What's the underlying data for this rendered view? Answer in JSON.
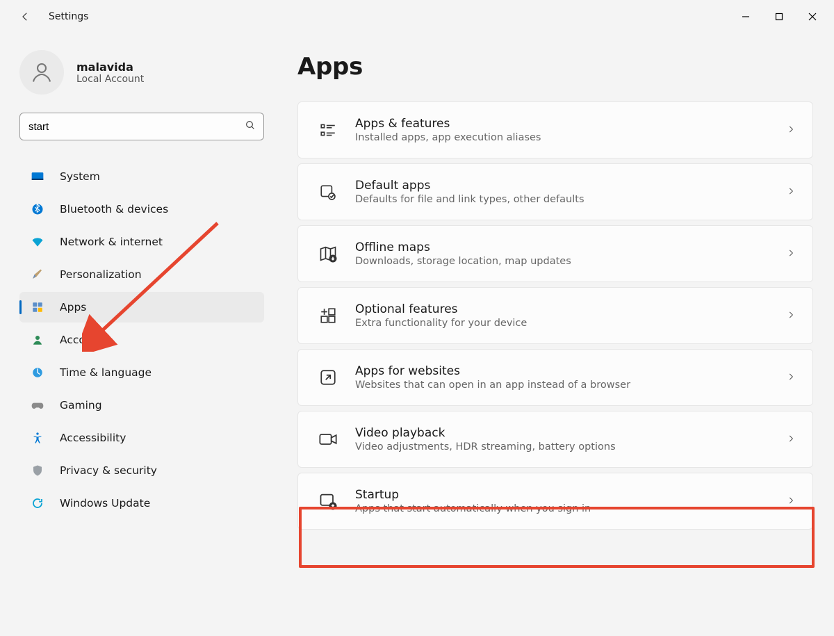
{
  "window": {
    "title": "Settings"
  },
  "account": {
    "name": "malavida",
    "subtitle": "Local Account"
  },
  "search": {
    "value": "start"
  },
  "nav": {
    "items": [
      {
        "id": "system",
        "label": "System"
      },
      {
        "id": "bluetooth",
        "label": "Bluetooth & devices"
      },
      {
        "id": "network",
        "label": "Network & internet"
      },
      {
        "id": "personalization",
        "label": "Personalization"
      },
      {
        "id": "apps",
        "label": "Apps"
      },
      {
        "id": "accounts",
        "label": "Accounts"
      },
      {
        "id": "time",
        "label": "Time & language"
      },
      {
        "id": "gaming",
        "label": "Gaming"
      },
      {
        "id": "accessibility",
        "label": "Accessibility"
      },
      {
        "id": "privacy",
        "label": "Privacy & security"
      },
      {
        "id": "update",
        "label": "Windows Update"
      }
    ]
  },
  "page": {
    "title": "Apps"
  },
  "cards": [
    {
      "id": "apps-features",
      "title": "Apps & features",
      "subtitle": "Installed apps, app execution aliases"
    },
    {
      "id": "default-apps",
      "title": "Default apps",
      "subtitle": "Defaults for file and link types, other defaults"
    },
    {
      "id": "offline-maps",
      "title": "Offline maps",
      "subtitle": "Downloads, storage location, map updates"
    },
    {
      "id": "optional-features",
      "title": "Optional features",
      "subtitle": "Extra functionality for your device"
    },
    {
      "id": "apps-websites",
      "title": "Apps for websites",
      "subtitle": "Websites that can open in an app instead of a browser"
    },
    {
      "id": "video-playback",
      "title": "Video playback",
      "subtitle": "Video adjustments, HDR streaming, battery options"
    },
    {
      "id": "startup",
      "title": "Startup",
      "subtitle": "Apps that start automatically when you sign in"
    }
  ]
}
